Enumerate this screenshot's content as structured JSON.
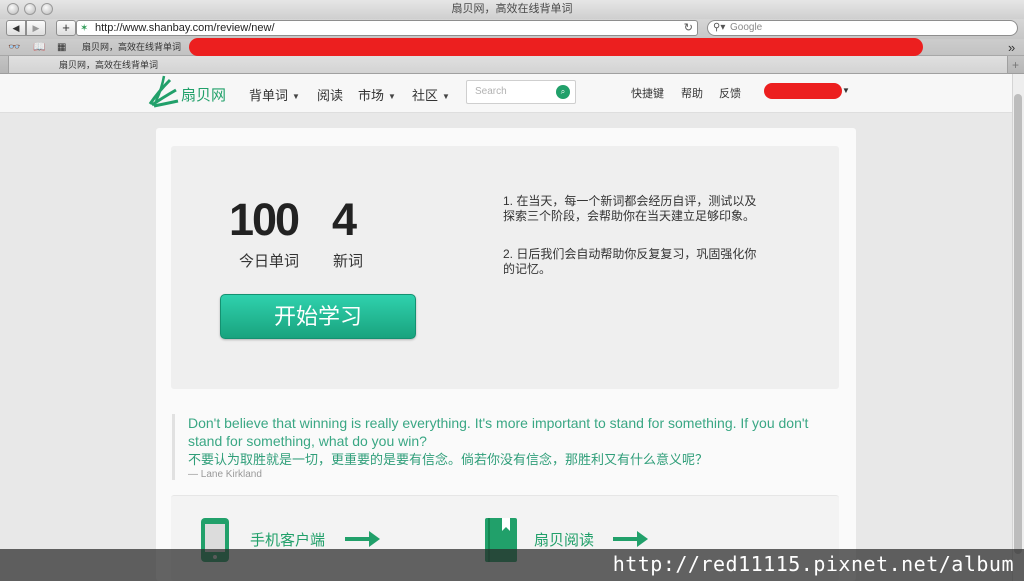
{
  "window": {
    "title": "扇贝网，高效在线背单词"
  },
  "browser": {
    "url": "http://www.shanbay.com/review/new/",
    "search_placeholder": "Google",
    "bookmark_label": "扇贝网，高效在线背单词",
    "tab_label": "扇贝网，高效在线背单词"
  },
  "site": {
    "logo_text": "扇贝网",
    "nav": [
      {
        "label": "背单词"
      },
      {
        "label": "阅读"
      },
      {
        "label": "市场"
      },
      {
        "label": "社区"
      }
    ],
    "search_placeholder": "Search",
    "links": {
      "shortcuts": "快捷键",
      "help": "帮助",
      "feedback": "反馈"
    }
  },
  "stats": {
    "today_count": "100",
    "today_label": "今日单词",
    "new_count": "4",
    "new_label": "新词"
  },
  "start_button": "开始学习",
  "tips": [
    {
      "line1": "1. 在当天，每一个新词都会经历自评，测试以及",
      "line2": "探索三个阶段，会帮助你在当天建立足够印象。"
    },
    {
      "line1": "2. 日后我们会自动帮助你反复复习，巩固强化你",
      "line2": "的记忆。"
    }
  ],
  "quote": {
    "english": "Don't believe that winning is really everything. It's more important to stand for something. If you don't stand for something, what do you win?",
    "chinese": "不要认为取胜就是一切，更重要的是要有信念。倘若你没有信念，那胜利又有什么意义呢？",
    "author": "— Lane Kirkland"
  },
  "apps": [
    {
      "label": "手机客户端"
    },
    {
      "label": "扇贝阅读"
    }
  ],
  "watermark": "http://red11115.pixnet.net/album",
  "colors": {
    "brand_green": "#21a06a",
    "button_top": "#2fd1ad",
    "button_bottom": "#19a37e",
    "redaction": "#ec1f1f"
  }
}
